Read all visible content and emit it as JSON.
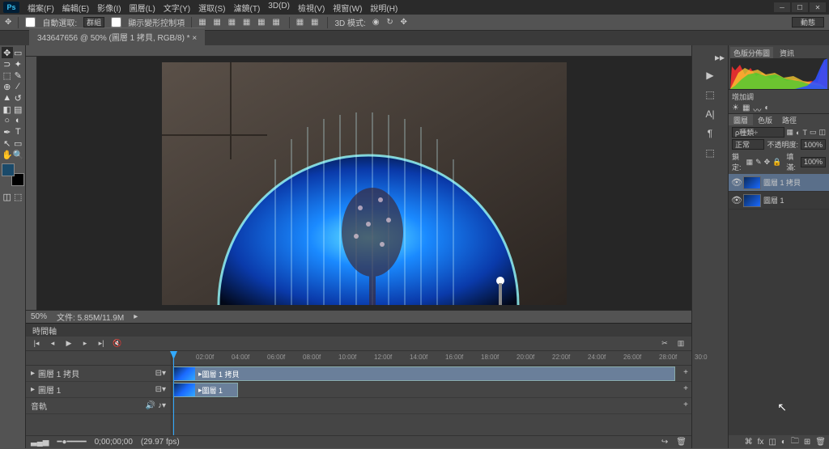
{
  "app": {
    "logo": "Ps"
  },
  "menu": [
    "檔案(F)",
    "編輯(E)",
    "影像(I)",
    "圖層(L)",
    "文字(Y)",
    "選取(S)",
    "濾鏡(T)",
    "3D(D)",
    "檢視(V)",
    "視窗(W)",
    "說明(H)"
  ],
  "options": {
    "auto_select": "自動選取:",
    "group": "群組",
    "transform": "顯示變形控制項",
    "mode3d_label": "3D 模式:",
    "workspace_btn": "動態"
  },
  "doc": {
    "tab": "343647656 @ 50% (圖層 1 拷貝, RGB/8) *",
    "zoom": "50%",
    "filesize": "文件: 5.85M/11.9M"
  },
  "timeline": {
    "tab": "時間軸",
    "ticks": [
      "02:00f",
      "04:00f",
      "06:00f",
      "08:00f",
      "10:00f",
      "12:00f",
      "14:00f",
      "16:00f",
      "18:00f",
      "20:00f",
      "22:00f",
      "24:00f",
      "26:00f",
      "28:00f",
      "30:0"
    ],
    "tracks": [
      {
        "name": "圖層 1 拷貝",
        "clip": "圖層 1 拷貝"
      },
      {
        "name": "圖層 1",
        "clip": "圖層 1"
      }
    ],
    "audio_track": "音軌",
    "timecode": "0;00;00;00",
    "fps": "(29.97 fps)"
  },
  "panels": {
    "histogram": {
      "tabs": [
        "色版分佈圖",
        "資訊"
      ]
    },
    "adjustments": {
      "tab": "增加調"
    },
    "layers": {
      "tabs": [
        "圖層",
        "色版",
        "路徑"
      ],
      "kind": "種類",
      "blend": "正常",
      "opacity_label": "不透明度:",
      "opacity": "100%",
      "lock_label": "鎖定:",
      "fill_label": "填滿:",
      "fill": "100%",
      "items": [
        {
          "name": "圖層 1 拷貝",
          "selected": true
        },
        {
          "name": "圖層 1",
          "selected": false
        }
      ]
    }
  },
  "dock_icons": [
    "▶",
    "⬚",
    "A|",
    "¶",
    "⬚"
  ]
}
